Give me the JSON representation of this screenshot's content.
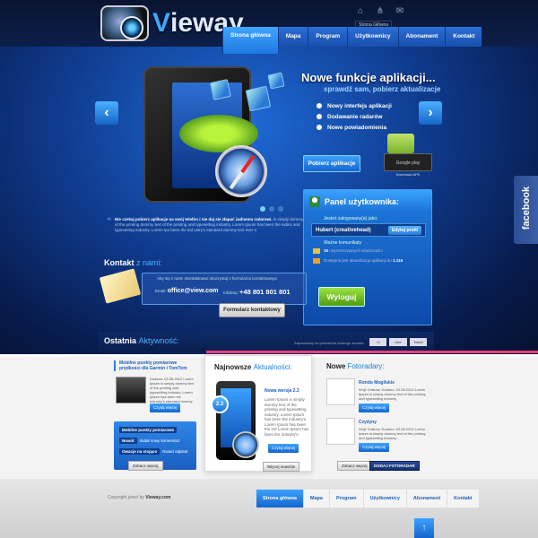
{
  "logo": {
    "brand": "Vieway"
  },
  "top_tooltip": "Strona Główna",
  "nav": [
    "Strona główna",
    "Mapa",
    "Program",
    "Użytkownicy",
    "Abonament",
    "Kontakt"
  ],
  "hero": {
    "title": "Nowe funkcje aplikacji...",
    "subtitle": "sprawdź sam, pobierz aktualizacje",
    "features": [
      "Nowy interfejs aplikacji",
      "Dodawanie radarów",
      "Nowe powiadomienia"
    ],
    "download_button": "Pobierz aplikacje",
    "store_label": "Google play",
    "store_caption": "Download APK",
    "prev": "‹",
    "next": "›"
  },
  "quote": {
    "bold": "Nie czekaj pobierz aplikacje na swój telefon i nie daj sie złapać żadnemu radarowi.",
    "text": "is simply dummy text of the printing dummy text of the printing and typesetting industry. Lorem Ipsum has been the indins and typesetting industry. Lorem Ips been the ind ustry's standard dummy text ever s"
  },
  "facebook": "facebook",
  "panel": {
    "title": "Panel użytkownika:",
    "logged_label": "Jesteś zalogowany(a) jako:",
    "username": "Hubert (creativehead)",
    "edit": "Edytuj profil",
    "messages_label": "Ważne komunikaty",
    "msg1_count": "15",
    "msg1_text": "nieprzeczytanych wiadomości",
    "msg2_text": "Dostępna jest aktualizacja aplikacji do",
    "msg2_version": "1.115",
    "logout": "Wyloguj"
  },
  "contact": {
    "title": "Kontakt",
    "title_accent": "z nami:",
    "intro": "Aby się z nami skontaktować skorzystaj z formularza kontaktowego",
    "email_label": "Email:",
    "email": "office@view.com",
    "phone_label": "Infolinia:",
    "phone": "+48 801 801 801",
    "form_button": "Formularz kontaktowy"
  },
  "activity": {
    "title": "Ostatnia",
    "title_accent": "Aktywność:",
    "invite": "Zapraszamy do polubienia naszego serwisu",
    "social": [
      "+1",
      "Like",
      "Tweet"
    ]
  },
  "col1": {
    "title": "Mobilne punkty pomiarowe prędkości dla Garmin i TomTom",
    "meta": "Dodano: 02.08.2012 Lorem Ipsum is simply dummy text of the printing and typesetting industry. Lorem Ipsum has been the industry's standard dummy text ever since",
    "read": "Czytaj więcej",
    "list": [
      {
        "tag": "Mobilne punkty pomiarowe",
        "text": ""
      },
      {
        "tag": "Nowid",
        "text": "dodał nowy komentarz"
      },
      {
        "tag": "Owacje na stojąco",
        "text": "Nowid odpisał"
      }
    ],
    "more": "Zobacz więcej"
  },
  "col2": {
    "title": "Najnowsze",
    "title_accent": "Aktualności:",
    "badge": "2.3",
    "news_title": "Nowa wersja 2.3",
    "news_text": "Lorem Ipsum is simply dummy text of the printing and typesetting industry. Lorem Ipsum has been the industry's. Lorem Ipsum has been the ind Lorem Ipsum has been the industry's",
    "read": "Czytaj więcej",
    "more": "Więcej newsów"
  },
  "col3": {
    "title": "Nowe",
    "title_accent": "Fotoradary:",
    "items": [
      {
        "name": "Rondo Mogilskie",
        "meta": "Wojt: Kraków, Dodano: 02.08.2012 Lorem Ipsum is simply dummy text of the printing and typesetting industry",
        "read": "Czytaj więcej"
      },
      {
        "name": "Czyżyny",
        "meta": "Wojt: Kraków, Dodano: 02.08.2012 Lorem Ipsum is simply dummy text of the printing and typesetting industry",
        "read": "Czytaj więcej"
      }
    ],
    "more": "Zobacz więcej",
    "add": "DODAJ FOTORADAR"
  },
  "footer": {
    "copy": "Copyright jewel by",
    "brand": "Vieway.com",
    "nav": [
      "Strona główna",
      "Mapa",
      "Program",
      "Użytkownicy",
      "Abonament",
      "Kontakt"
    ],
    "top": "↑"
  }
}
